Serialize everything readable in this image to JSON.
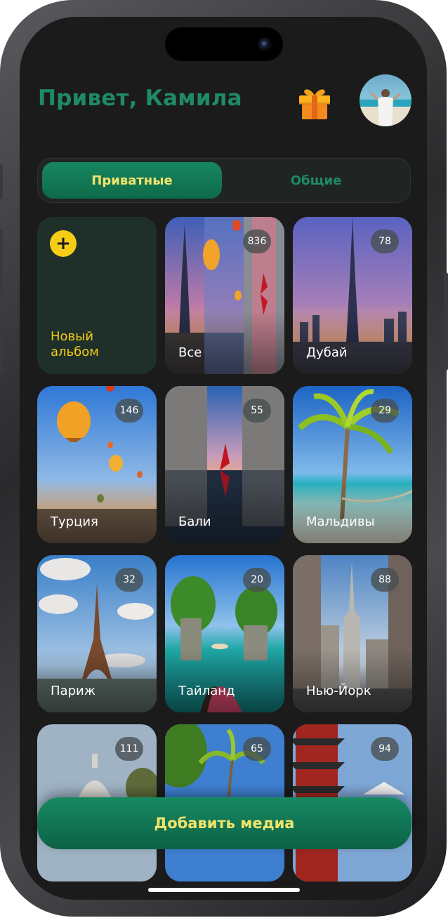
{
  "header": {
    "greeting": "Привет, Камила"
  },
  "tabs": [
    {
      "label": "Приватные",
      "active": true
    },
    {
      "label": "Общие",
      "active": false
    }
  ],
  "new_album": {
    "label": "Новый альбом",
    "icon": "plus-icon"
  },
  "albums": [
    {
      "label": "Все",
      "count": "836"
    },
    {
      "label": "Дубай",
      "count": "78"
    },
    {
      "label": "Турция",
      "count": "146"
    },
    {
      "label": "Бали",
      "count": "55"
    },
    {
      "label": "Мальдивы",
      "count": "29"
    },
    {
      "label": "Париж",
      "count": "32"
    },
    {
      "label": "Тайланд",
      "count": "20"
    },
    {
      "label": "Нью-Йорк",
      "count": "88"
    },
    {
      "label": "",
      "count": "111"
    },
    {
      "label": "",
      "count": "65"
    },
    {
      "label": "",
      "count": "94"
    }
  ],
  "actions": {
    "add_media": "Добавить медиа"
  },
  "colors": {
    "brand_green": "#1f8a66",
    "accent_yellow": "#f5cc16",
    "background": "#1b1b1b"
  }
}
